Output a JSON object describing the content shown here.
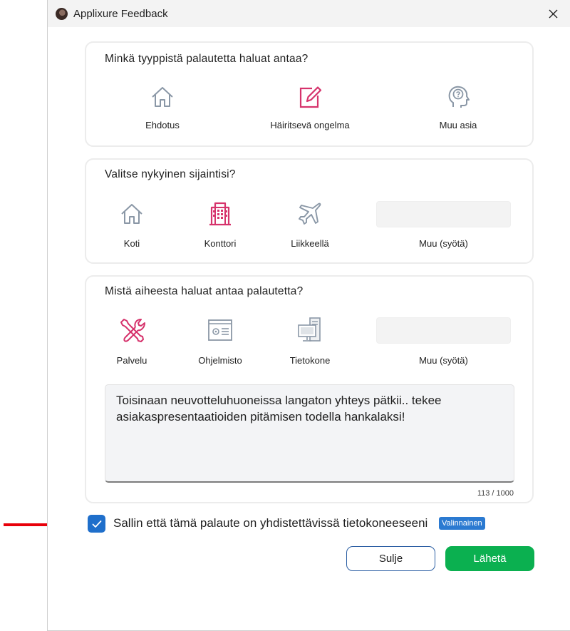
{
  "window": {
    "title": "Applixure Feedback"
  },
  "feedback_type": {
    "question": "Minkä tyyppistä palautetta haluat antaa?",
    "options": [
      {
        "label": "Ehdotus",
        "icon": "house-icon",
        "selected": false
      },
      {
        "label": "Häiritsevä ongelma",
        "icon": "edit-icon",
        "selected": true
      },
      {
        "label": "Muu asia",
        "icon": "head-question-icon",
        "selected": false
      }
    ]
  },
  "location": {
    "question": "Valitse nykyinen sijaintisi?",
    "options": [
      {
        "label": "Koti",
        "icon": "house-icon",
        "selected": false
      },
      {
        "label": "Konttori",
        "icon": "office-building-icon",
        "selected": true
      },
      {
        "label": "Liikkeellä",
        "icon": "airplane-icon",
        "selected": false
      }
    ],
    "other_label": "Muu (syötä)",
    "other_value": ""
  },
  "topic": {
    "question": "Mistä aiheesta haluat antaa palautetta?",
    "options": [
      {
        "label": "Palvelu",
        "icon": "tools-icon",
        "selected": true
      },
      {
        "label": "Ohjelmisto",
        "icon": "software-window-icon",
        "selected": false
      },
      {
        "label": "Tietokone",
        "icon": "computer-icon",
        "selected": false
      }
    ],
    "other_label": "Muu (syötä)",
    "other_value": "",
    "message": "Toisinaan neuvotteluhuoneissa langaton yhteys pätkii.. tekee asiakaspresentaatioiden pitämisen todella hankalaksi!",
    "counter": "113 / 1000"
  },
  "consent": {
    "checked": true,
    "label": "Sallin että tämä palaute on yhdistettävissä tietokoneeseeni",
    "badge": "Valinnainen"
  },
  "buttons": {
    "close": "Sulje",
    "send": "Lähetä"
  },
  "colors": {
    "accent_pink": "#d6336c",
    "icon_gray": "#8a97a6",
    "checkbox_blue": "#1f6fcb",
    "send_green": "#0bb050",
    "arrow_red": "#e8000a"
  }
}
